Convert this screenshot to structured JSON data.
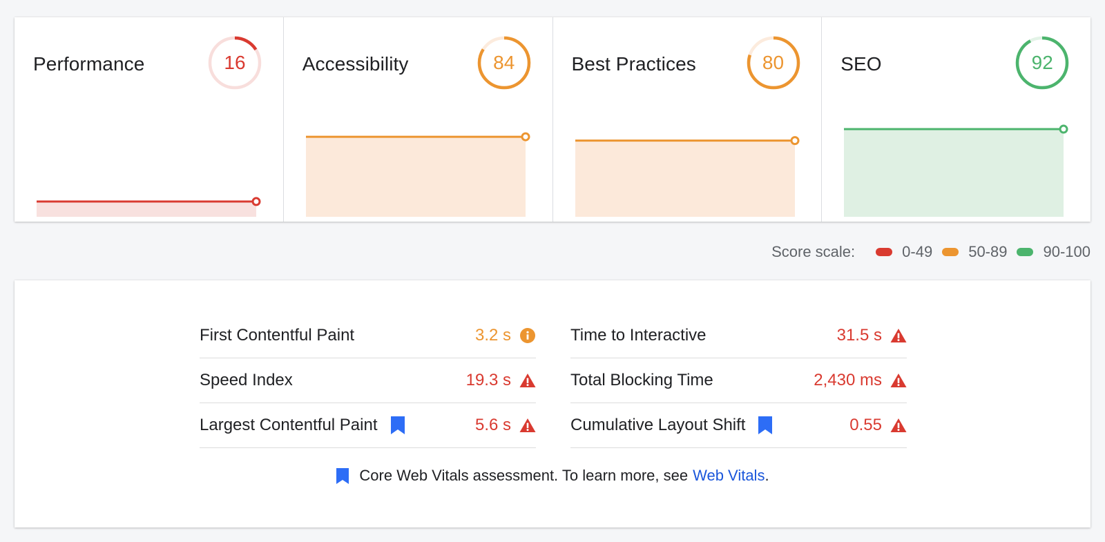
{
  "colors": {
    "fail": "#d93a30",
    "fail_bg": "#f8e1df",
    "fail_track": "#f8dedc",
    "average": "#ec9530",
    "average_bg": "#fce9da",
    "average_track": "#fcebdd",
    "pass": "#4cb46d",
    "pass_bg": "#dff0e3",
    "pass_track": "#e3f3e7",
    "link": "#1a56db",
    "bookmark": "#2d6df6"
  },
  "categories": [
    {
      "title": "Performance",
      "score": 16,
      "status": "fail"
    },
    {
      "title": "Accessibility",
      "score": 84,
      "status": "average"
    },
    {
      "title": "Best Practices",
      "score": 80,
      "status": "average"
    },
    {
      "title": "SEO",
      "score": 92,
      "status": "pass"
    }
  ],
  "score_scale": {
    "label": "Score scale:",
    "ranges": [
      {
        "label": "0-49",
        "status": "fail"
      },
      {
        "label": "50-89",
        "status": "average"
      },
      {
        "label": "90-100",
        "status": "pass"
      }
    ]
  },
  "metrics": [
    {
      "name": "First Contentful Paint",
      "value": "3.2 s",
      "status": "average",
      "status_icon": "info-icon",
      "core_web_vital": false
    },
    {
      "name": "Time to Interactive",
      "value": "31.5 s",
      "status": "fail",
      "status_icon": "warning-icon",
      "core_web_vital": false
    },
    {
      "name": "Speed Index",
      "value": "19.3 s",
      "status": "fail",
      "status_icon": "warning-icon",
      "core_web_vital": false
    },
    {
      "name": "Total Blocking Time",
      "value": "2,430 ms",
      "status": "fail",
      "status_icon": "warning-icon",
      "core_web_vital": false
    },
    {
      "name": "Largest Contentful Paint",
      "value": "5.6 s",
      "status": "fail",
      "status_icon": "warning-icon",
      "core_web_vital": true
    },
    {
      "name": "Cumulative Layout Shift",
      "value": "0.55",
      "status": "fail",
      "status_icon": "warning-icon",
      "core_web_vital": true
    }
  ],
  "footnote": {
    "text": "Core Web Vitals assessment. To learn more, see",
    "link": "Web Vitals",
    "end": "."
  }
}
